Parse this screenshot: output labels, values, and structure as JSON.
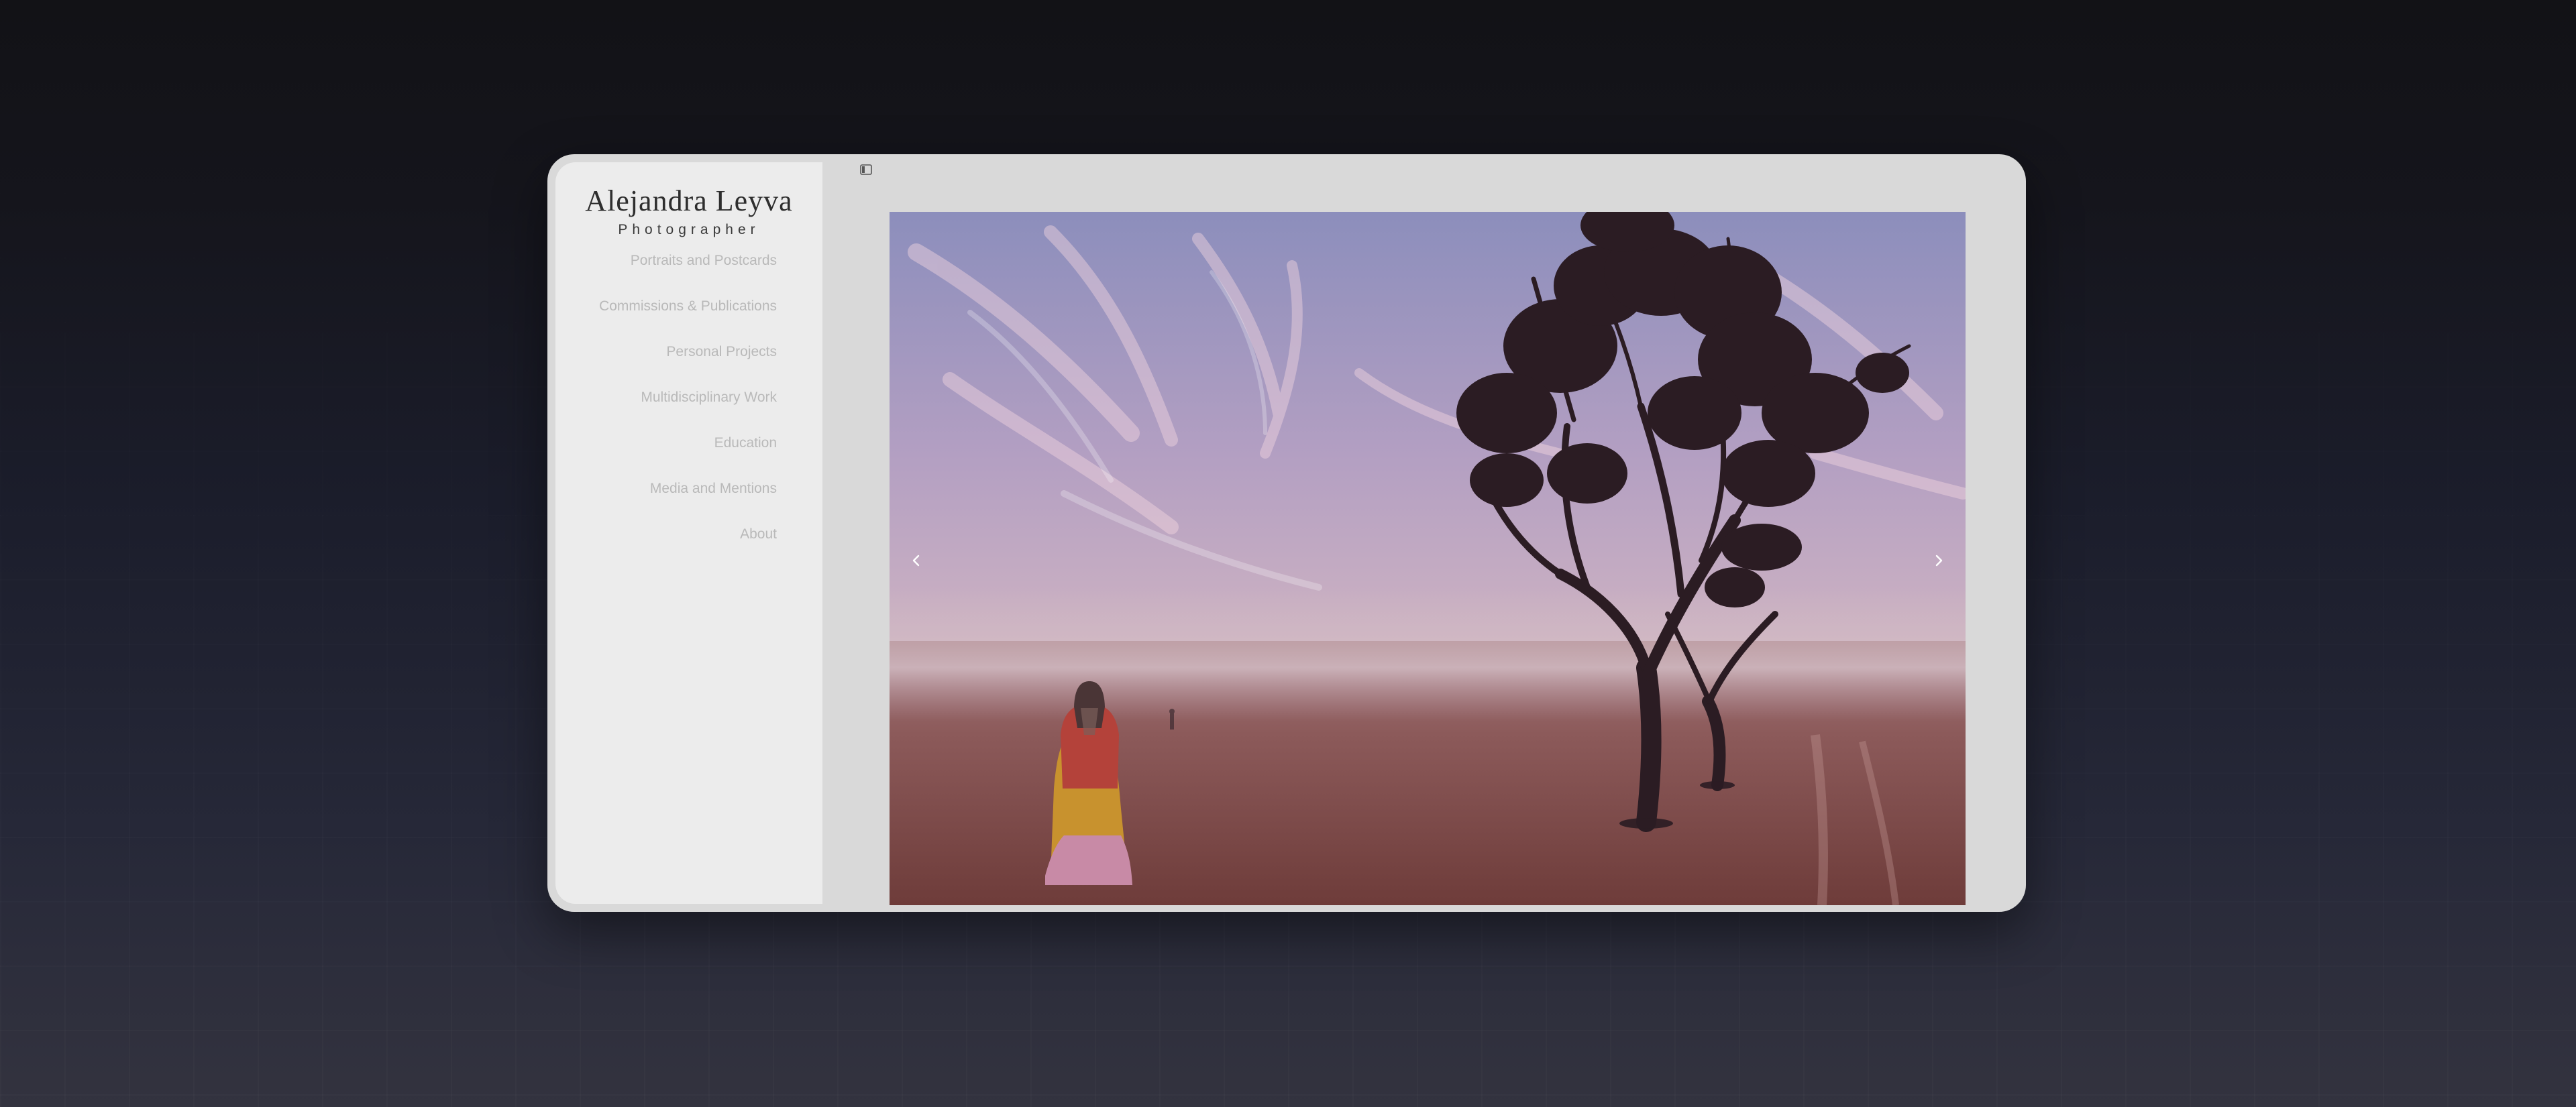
{
  "site": {
    "name": "Alejandra Leyva",
    "subtitle": "Photographer"
  },
  "nav": {
    "items": [
      "Portraits and Postcards",
      "Commissions & Publications",
      "Personal Projects",
      "Multidisciplinary Work",
      "Education",
      "Media and Mentions",
      "About"
    ]
  },
  "icons": {
    "sidebar_toggle": "sidebar-toggle-icon",
    "previous": "chevron-left-icon",
    "next": "chevron-right-icon"
  },
  "colors": {
    "page_background": "#15151c",
    "window_background": "#d9d9d9",
    "sidebar_background": "#ececec",
    "logo_text": "#2e2e2e",
    "nav_text": "#b9b9b9"
  }
}
